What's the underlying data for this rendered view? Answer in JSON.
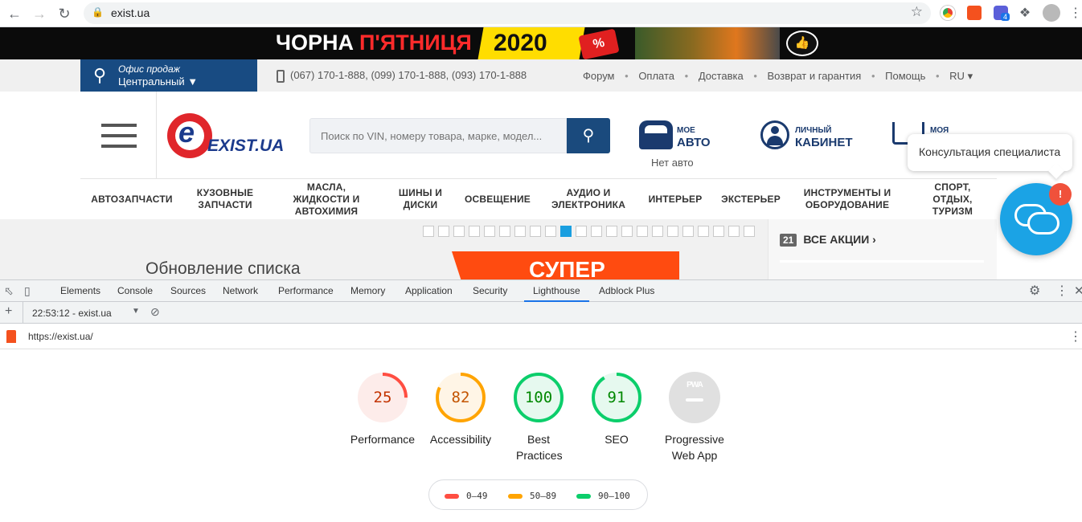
{
  "browser": {
    "url": "exist.ua",
    "extension_badge": "4"
  },
  "banner": {
    "text_white": "ЧОРНА",
    "text_red": "П'ЯТНИЦЯ",
    "year": "2020",
    "percent": "%"
  },
  "site": {
    "office_label": "Офис продаж",
    "office_name": "Центральный",
    "phones": "(067) 170-1-888,  (099) 170-1-888,  (093) 170-1-888",
    "top_links": [
      "Форум",
      "Оплата",
      "Доставка",
      "Возврат и гарантия",
      "Помощь",
      "RU"
    ],
    "logo_text": "EXIST.UA",
    "search_placeholder": "Поиск по VIN, номеру товара, марке, модел...",
    "my_auto_small": "МОЕ",
    "my_auto_big": "АВТО",
    "no_auto": "Нет авто",
    "cabinet_small": "ЛИЧНЫЙ",
    "cabinet_big": "КАБИНЕТ",
    "cart_small": "МОЯ",
    "categories": [
      "АВТОЗАПЧАСТИ",
      "КУЗОВНЫЕ ЗАПЧАСТИ",
      "МАСЛА, ЖИДКОСТИ И АВТОХИМИЯ",
      "ШИНЫ И ДИСКИ",
      "ОСВЕЩЕНИЕ",
      "АУДИО И ЭЛЕКТРОНИКА",
      "ИНТЕРЬЕР",
      "ЭКСТЕРЬЕР",
      "ИНСТРУМЕНТЫ И ОБОРУДОВАНИЕ",
      "СПОРТ, ОТДЫХ, ТУРИЗМ"
    ],
    "slide_title": "Обновление списка",
    "slide_promo": "СУПЕР",
    "slider_total": 22,
    "slider_active": 10,
    "promo_count": "21",
    "promo_label": "ВСЕ АКЦИИ",
    "consult_text": "Консультация специалиста",
    "chat_badge": "!"
  },
  "devtools": {
    "tabs": [
      "Elements",
      "Console",
      "Sources",
      "Network",
      "Performance",
      "Memory",
      "Application",
      "Security",
      "Lighthouse",
      "Adblock Plus"
    ],
    "active_tab": "Lighthouse",
    "report_time": "22:53:12 - exist.ua",
    "report_url": "https://exist.ua/"
  },
  "lighthouse": {
    "scores": [
      {
        "label": "Performance",
        "score": "25",
        "value": 25,
        "color": "#ff4e42",
        "bg": "#fdecea"
      },
      {
        "label": "Accessibility",
        "score": "82",
        "value": 82,
        "color": "#ffa400",
        "bg": "#fff5e6"
      },
      {
        "label": "Best Practices",
        "score": "100",
        "value": 100,
        "color": "#0cce6b",
        "bg": "#e6f9ef"
      },
      {
        "label": "SEO",
        "score": "91",
        "value": 91,
        "color": "#0cce6b",
        "bg": "#e6f9ef"
      },
      {
        "label": "Progressive Web App",
        "score": "PWA",
        "value": null,
        "color": "#cccccc",
        "bg": "#e0e0e0"
      }
    ],
    "legend": [
      {
        "range": "0–49",
        "color": "#ff4e42"
      },
      {
        "range": "50–89",
        "color": "#ffa400"
      },
      {
        "range": "90–100",
        "color": "#0cce6b"
      }
    ]
  }
}
